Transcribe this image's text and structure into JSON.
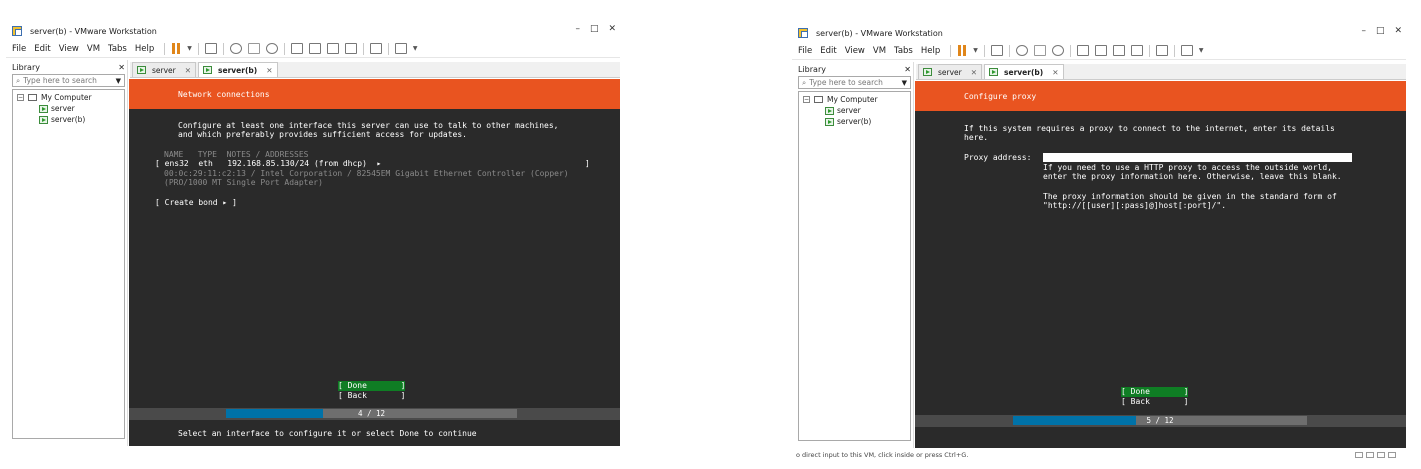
{
  "win1": {
    "title": "server(b) - VMware Workstation",
    "ctrl_min": "–",
    "ctrl_max": "□",
    "ctrl_close": "✕",
    "menu": {
      "file": "File",
      "edit": "Edit",
      "view": "View",
      "vm": "VM",
      "tabs": "Tabs",
      "help": "Help"
    },
    "library": {
      "title": "Library",
      "close": "✕",
      "search_placeholder": "Type here to search",
      "tree": {
        "root": "My Computer",
        "vm1": "server",
        "vm2": "server(b)"
      }
    },
    "tabs": {
      "t1": "server",
      "t2": "server(b)"
    },
    "installer": {
      "header": "Network connections",
      "intro_1": "Configure at least one interface this server can use to talk to other machines,",
      "intro_2": "and which preferably provides sufficient access for updates.",
      "table_header": "NAME   TYPE  NOTES / ADDRESSES",
      "iface_open": "[ ens32  eth   192.168.85.130/24 (from dhcp)  ▸",
      "iface_close": "]",
      "iface_detail_1": "00:0c:29:11:c2:13 / Intel Corporation / 82545EM Gigabit Ethernet Controller (Copper)",
      "iface_detail_2": "(PRO/1000 MT Single Port Adapter)",
      "create_bond": "[ Create bond ▸ ]",
      "done": "[ Done       ]",
      "back": "[ Back       ]",
      "progress_label": "4 / 12",
      "progress_value": 0.333,
      "footer": "Select an interface to configure it or select Done to continue"
    }
  },
  "win2": {
    "title": "server(b) - VMware Workstation",
    "ctrl_min": "–",
    "ctrl_max": "□",
    "ctrl_close": "✕",
    "menu": {
      "file": "File",
      "edit": "Edit",
      "view": "View",
      "vm": "VM",
      "tabs": "Tabs",
      "help": "Help"
    },
    "library": {
      "title": "Library",
      "close": "✕",
      "search_placeholder": "Type here to search",
      "tree": {
        "root": "My Computer",
        "vm1": "server",
        "vm2": "server(b)"
      }
    },
    "tabs": {
      "t1": "server",
      "t2": "server(b)"
    },
    "installer": {
      "header": "Configure proxy",
      "intro_1": "If this system requires a proxy to connect to the internet, enter its details",
      "intro_2": "here.",
      "proxy_label": "Proxy address:",
      "help_1": "If you need to use a HTTP proxy to access the outside world,",
      "help_2": "enter the proxy information here. Otherwise, leave this blank.",
      "help_3": "The proxy information should be given in the standard form of",
      "help_4": "\"http://[[user][:pass]@]host[:port]/\".",
      "done": "[ Done       ]",
      "back": "[ Back       ]",
      "progress_label": "5 / 12",
      "progress_value": 0.417
    },
    "status_text": "o direct input to this VM, click inside or press Ctrl+G."
  }
}
